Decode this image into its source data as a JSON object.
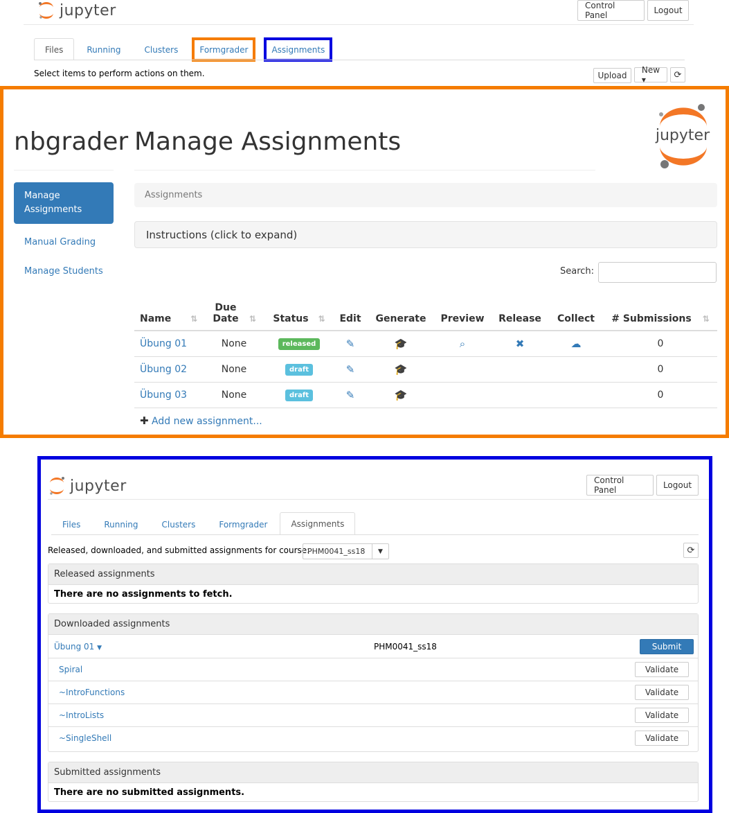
{
  "top": {
    "logo_text": "jupyter",
    "control_panel": "Control Panel",
    "logout": "Logout",
    "tabs": [
      "Files",
      "Running",
      "Clusters",
      "Formgrader",
      "Assignments"
    ],
    "hint": "Select items to perform actions on them.",
    "upload": "Upload",
    "new": "New ▾",
    "refresh_icon": "refresh-icon"
  },
  "nbgrader": {
    "brand": "nbgrader",
    "page_title": "Manage Assignments",
    "logo_text": "jupyter",
    "sidebar": [
      "Manage Assignments",
      "Manual Grading",
      "Manage Students"
    ],
    "breadcrumb": "Assignments",
    "instructions": "Instructions (click to expand)",
    "search_label": "Search:",
    "search_value": "",
    "columns": [
      "Name",
      "Due Date",
      "Status",
      "Edit",
      "Generate",
      "Preview",
      "Release",
      "Collect",
      "# Submissions"
    ],
    "rows": [
      {
        "name": "Übung 01",
        "due": "None",
        "status": "released",
        "status_color": "#5cb85c",
        "preview": true,
        "release": true,
        "collect": true,
        "submissions": "0"
      },
      {
        "name": "Übung 02",
        "due": "None",
        "status": "draft",
        "status_color": "#5bc0de",
        "preview": false,
        "release": false,
        "collect": false,
        "submissions": "0"
      },
      {
        "name": "Übung 03",
        "due": "None",
        "status": "draft",
        "status_color": "#5bc0de",
        "preview": false,
        "release": false,
        "collect": false,
        "submissions": "0"
      }
    ],
    "add_new": "Add new assignment..."
  },
  "student": {
    "logo_text": "jupyter",
    "control_panel": "Control Panel",
    "logout": "Logout",
    "tabs": [
      "Files",
      "Running",
      "Clusters",
      "Formgrader",
      "Assignments"
    ],
    "course_label": "Released, downloaded, and submitted assignments for course:",
    "course_value": "PHM0041_ss18",
    "released_head": "Released assignments",
    "released_body": "There are no assignments to fetch.",
    "downloaded_head": "Downloaded assignments",
    "downloaded_assignment": "Übung 01",
    "downloaded_course": "PHM0041_ss18",
    "submit": "Submit",
    "notebooks": [
      "Spiral",
      "~IntroFunctions",
      "~IntroLists",
      "~SingleShell"
    ],
    "validate": "Validate",
    "submitted_head": "Submitted assignments",
    "submitted_body": "There are no submitted assignments."
  },
  "colors": {
    "highlight_orange": "#f57c00",
    "highlight_blue": "#0000e0",
    "link": "#337ab7",
    "jupyter_orange": "#f37726"
  }
}
